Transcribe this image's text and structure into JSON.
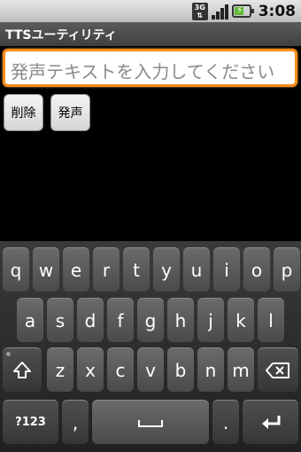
{
  "status_bar": {
    "network": "3G",
    "time": "3:08",
    "battery_level": 0.6
  },
  "app": {
    "title": "TTSユーティリティ"
  },
  "input": {
    "placeholder": "発声テキストを入力してください"
  },
  "buttons": {
    "delete_label": "削除",
    "speak_label": "発声"
  },
  "keyboard": {
    "row1": [
      "q",
      "w",
      "e",
      "r",
      "t",
      "y",
      "u",
      "i",
      "o",
      "p"
    ],
    "row2": [
      "a",
      "s",
      "d",
      "f",
      "g",
      "h",
      "j",
      "k",
      "l"
    ],
    "row3": [
      "z",
      "x",
      "c",
      "v",
      "b",
      "n",
      "m"
    ],
    "symbols_label": "?123",
    "comma_label": ",",
    "period_label": "."
  }
}
